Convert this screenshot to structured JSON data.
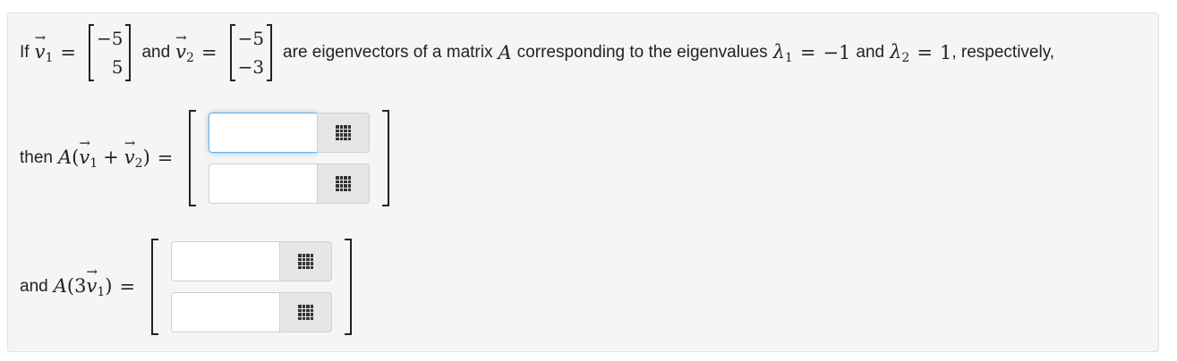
{
  "question": {
    "if_word": "If",
    "and_word": "and",
    "v1_entries": [
      "−5",
      "5"
    ],
    "v2_entries": [
      "−5",
      "−3"
    ],
    "middle_text": "are eigenvectors of a matrix",
    "matrix_letter": "A",
    "corr_text": "corresponding to the eigenvalues",
    "lambda_symbol": "λ",
    "lambda1_value": "−1",
    "lambda2_value": "1",
    "respectively": ", respectively,",
    "v_letter": "v",
    "sub1": "1",
    "sub2": "2",
    "eq": "=",
    "and_between": "and"
  },
  "part1": {
    "prefix": "then",
    "A": "A",
    "open": "(",
    "plus": "+",
    "close": ")",
    "v": "v",
    "sub1": "1",
    "sub2": "2",
    "eq": "=",
    "inputs": [
      {
        "value": "",
        "placeholder": ""
      },
      {
        "value": "",
        "placeholder": ""
      }
    ]
  },
  "part2": {
    "prefix": "and",
    "A": "A",
    "open": "(",
    "coef": "3",
    "close": ")",
    "v": "v",
    "sub1": "1",
    "eq": "=",
    "inputs": [
      {
        "value": "",
        "placeholder": ""
      },
      {
        "value": "",
        "placeholder": ""
      }
    ]
  },
  "icons": {
    "matrix_entry": "grid-icon"
  },
  "colors": {
    "panel_bg": "#f5f5f5",
    "focus_border": "#66afe9",
    "button_bg": "#e6e6e6"
  }
}
